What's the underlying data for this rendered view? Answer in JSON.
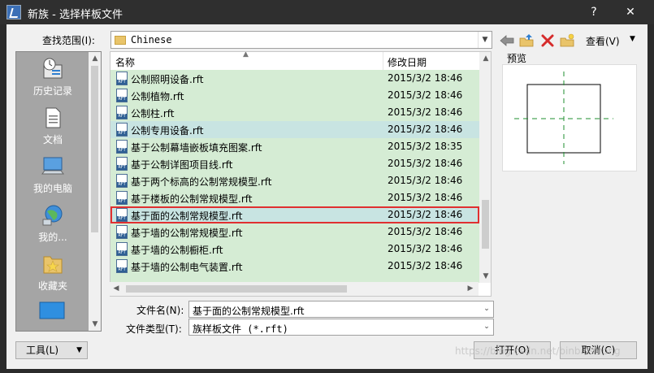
{
  "window": {
    "title": "新族 - 选择样板文件",
    "help_label": "?",
    "close_label": "✕"
  },
  "lookin": {
    "label": "查找范围(I):",
    "value": "Chinese"
  },
  "toolbar": {
    "view_label": "查看(V)"
  },
  "places": [
    {
      "label": "历史记录",
      "icon": "history-icon"
    },
    {
      "label": "文档",
      "icon": "documents-icon"
    },
    {
      "label": "我的电脑",
      "icon": "computer-icon"
    },
    {
      "label": "我的...",
      "icon": "network-icon"
    },
    {
      "label": "收藏夹",
      "icon": "favorites-icon"
    }
  ],
  "file_list": {
    "columns": [
      "名称",
      "修改日期"
    ],
    "rows": [
      {
        "name": "公制照明设备.rft",
        "date": "2015/3/2 18:46"
      },
      {
        "name": "公制植物.rft",
        "date": "2015/3/2 18:46"
      },
      {
        "name": "公制柱.rft",
        "date": "2015/3/2 18:46"
      },
      {
        "name": "公制专用设备.rft",
        "date": "2015/3/2 18:46"
      },
      {
        "name": "基于公制幕墙嵌板填充图案.rft",
        "date": "2015/3/2 18:35"
      },
      {
        "name": "基于公制详图项目线.rft",
        "date": "2015/3/2 18:46"
      },
      {
        "name": "基于两个标高的公制常规模型.rft",
        "date": "2015/3/2 18:46"
      },
      {
        "name": "基于楼板的公制常规模型.rft",
        "date": "2015/3/2 18:46"
      },
      {
        "name": "基于面的公制常规模型.rft",
        "date": "2015/3/2 18:46"
      },
      {
        "name": "基于墙的公制常规模型.rft",
        "date": "2015/3/2 18:46"
      },
      {
        "name": "基于墙的公制橱柜.rft",
        "date": "2015/3/2 18:46"
      },
      {
        "name": "基于墙的公制电气装置.rft",
        "date": "2015/3/2 18:46"
      }
    ],
    "selected_index": 8
  },
  "preview": {
    "label": "预览"
  },
  "filename": {
    "label": "文件名(N):",
    "value": "基于面的公制常规模型.rft"
  },
  "filetype": {
    "label": "文件类型(T):",
    "value": "族样板文件 (*.rft)"
  },
  "buttons": {
    "tools": "工具(L)",
    "open": "打开(O)",
    "cancel": "取消(C)"
  },
  "watermark": "https://blog.csdn.net/binbinstrong"
}
